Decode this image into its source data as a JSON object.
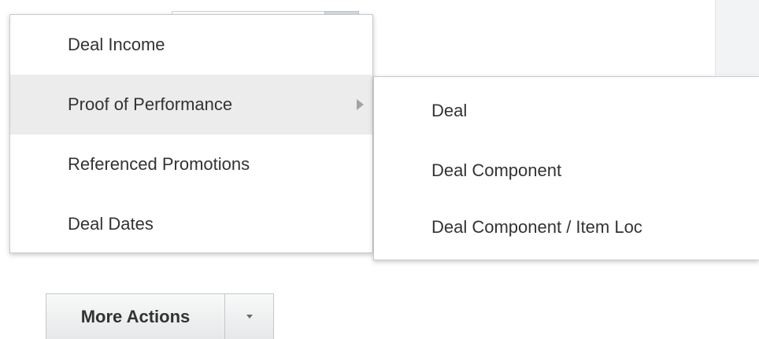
{
  "menu": {
    "items": [
      {
        "label": "Deal Income"
      },
      {
        "label": "Proof of Performance",
        "has_submenu": true,
        "highlighted": true
      },
      {
        "label": "Referenced Promotions"
      },
      {
        "label": "Deal Dates"
      }
    ]
  },
  "submenu": {
    "items": [
      {
        "label": "Deal"
      },
      {
        "label": "Deal Component"
      },
      {
        "label": "Deal Component / Item Loc"
      }
    ]
  },
  "toolbar": {
    "more_actions_label": "More Actions"
  },
  "icons": {
    "submenu_indicator": "chevron-right-icon",
    "split_dropdown": "chevron-down-icon"
  },
  "colors": {
    "text": "#333333",
    "highlight_bg": "#ececec",
    "border": "#c6cacd"
  }
}
